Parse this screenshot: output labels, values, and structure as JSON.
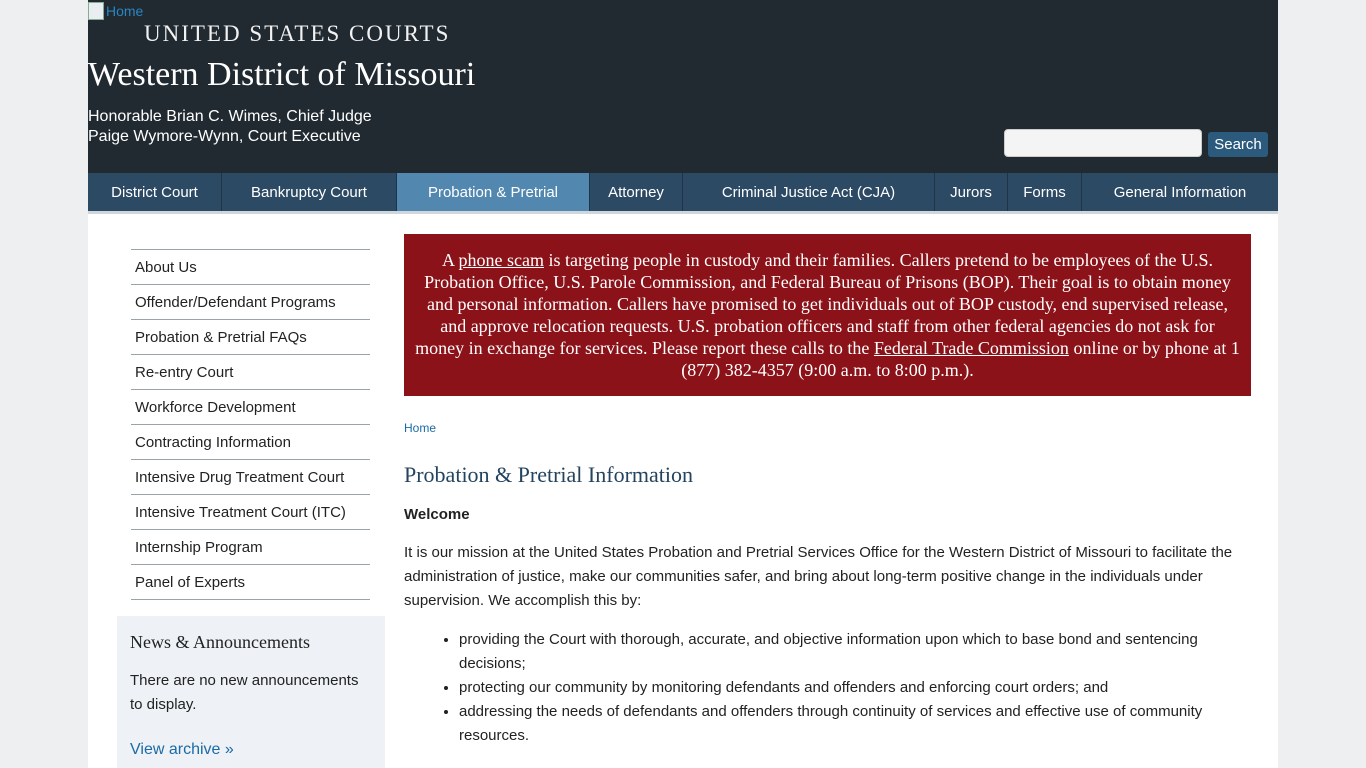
{
  "header": {
    "home_alt": "Home",
    "org": "UNITED STATES COURTS",
    "district": "Western District of Missouri",
    "judge": "Honorable Brian C. Wimes, Chief Judge",
    "executive": "Paige Wymore-Wynn, Court Executive",
    "search_value": "",
    "search_button": "Search"
  },
  "nav": {
    "items": [
      {
        "label": "District Court"
      },
      {
        "label": "Bankruptcy Court"
      },
      {
        "label": "Probation & Pretrial"
      },
      {
        "label": "Attorney"
      },
      {
        "label": "Criminal Justice Act (CJA)"
      },
      {
        "label": "Jurors"
      },
      {
        "label": "Forms"
      },
      {
        "label": "General Information"
      }
    ],
    "active_index": 2
  },
  "sidebar": {
    "items": [
      {
        "label": "About Us"
      },
      {
        "label": "Offender/Defendant Programs"
      },
      {
        "label": "Probation & Pretrial FAQs"
      },
      {
        "label": "Re-entry Court"
      },
      {
        "label": "Workforce Development"
      },
      {
        "label": "Contracting Information"
      },
      {
        "label": "Intensive Drug Treatment Court"
      },
      {
        "label": "Intensive Treatment Court (ITC)"
      },
      {
        "label": "Internship Program"
      },
      {
        "label": "Panel of Experts"
      }
    ]
  },
  "news": {
    "title": "News & Announcements",
    "body": "There are no new announcements to display.",
    "link": "View archive »"
  },
  "alert": {
    "pre": "A ",
    "link1": "phone scam",
    "mid": " is targeting people in custody and their families. Callers pretend to be employees of the U.S. Probation Office, U.S. Parole Commission, and Federal Bureau of Prisons (BOP). Their goal is to obtain money and personal information. Callers have promised to get individuals out of BOP custody, end supervised release, and approve relocation requests. U.S. probation officers and staff from other federal agencies do not ask for money in exchange for services. Please report these calls to the ",
    "link2": "Federal Trade Commission",
    "post": " online or by phone at 1 (877) 382-4357 (9:00 a.m. to 8:00 p.m.).",
    "color": "#8b1218"
  },
  "main": {
    "breadcrumb": "Home",
    "title": "Probation & Pretrial Information",
    "welcome": "Welcome",
    "mission": "It is our mission at the United States Probation and Pretrial Services Office for the Western District of Missouri to facilitate the administration of justice, make our communities safer, and bring about long-term positive change in the individuals under supervision. We accomplish this by:",
    "bullets": [
      "providing the Court with thorough, accurate, and objective information upon which to base bond and sentencing decisions;",
      "protecting our community by monitoring defendants and offenders and enforcing court orders; and",
      "addressing the needs of defendants and offenders through continuity of services and effective use of community resources."
    ]
  }
}
